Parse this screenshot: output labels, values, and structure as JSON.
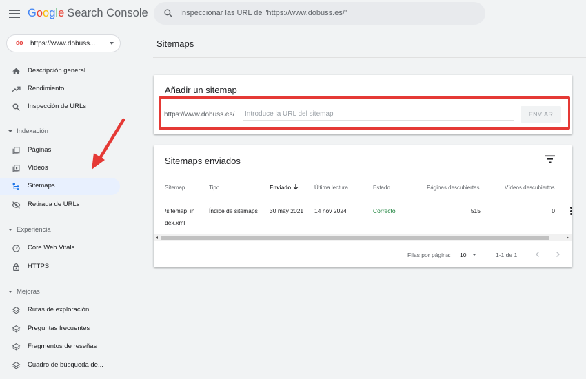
{
  "header": {
    "logo_google": [
      "G",
      "o",
      "o",
      "g",
      "l",
      "e"
    ],
    "logo_product": "Search Console",
    "search_placeholder": "Inspeccionar las URL de \"https://www.dobuss.es/\""
  },
  "sidebar": {
    "property": {
      "logo_text": "do",
      "label": "https://www.dobuss..."
    },
    "items": [
      {
        "label": "Descripción general",
        "icon": "home-icon"
      },
      {
        "label": "Rendimiento",
        "icon": "trending-up-icon"
      },
      {
        "label": "Inspección de URLs",
        "icon": "search-icon"
      },
      {
        "label": "Páginas",
        "icon": "pages-icon"
      },
      {
        "label": "Vídeos",
        "icon": "video-icon"
      },
      {
        "label": "Sitemaps",
        "icon": "sitemap-icon",
        "active": true
      },
      {
        "label": "Retirada de URLs",
        "icon": "removal-icon"
      },
      {
        "label": "Core Web Vitals",
        "icon": "gauge-icon"
      },
      {
        "label": "HTTPS",
        "icon": "lock-icon"
      },
      {
        "label": "Rutas de exploración",
        "icon": "layers-icon"
      },
      {
        "label": "Preguntas frecuentes",
        "icon": "layers-icon"
      },
      {
        "label": "Fragmentos de reseñas",
        "icon": "layers-icon"
      },
      {
        "label": "Cuadro de búsqueda de...",
        "icon": "layers-icon"
      }
    ],
    "sections": [
      "Indexación",
      "Experiencia",
      "Mejoras"
    ]
  },
  "main": {
    "page_title": "Sitemaps",
    "add_sitemap": {
      "title": "Añadir un sitemap",
      "url_prefix": "https://www.dobuss.es/",
      "input_placeholder": "Introduce la URL del sitemap",
      "submit_label": "ENVIAR"
    },
    "submitted": {
      "title": "Sitemaps enviados",
      "columns": [
        "Sitemap",
        "Tipo",
        "Enviado",
        "Última lectura",
        "Estado",
        "Páginas descubiertas",
        "Vídeos descubiertos"
      ],
      "sorted_column": "Enviado",
      "rows": [
        {
          "sitemap": [
            "/sitemap_in",
            "dex.xml"
          ],
          "type": "Índice de sitemaps",
          "submitted": "30 may 2021",
          "last_read": "14 nov 2024",
          "status": "Correcto",
          "pages": "515",
          "videos": "0"
        }
      ],
      "pagination": {
        "rows_label": "Filas por página:",
        "rows_per_page": "10",
        "range": "1-1 de 1"
      }
    }
  },
  "colors": {
    "accent_blue": "#1a73e8",
    "active_bg": "#e8f0fe",
    "success_green": "#188038",
    "annotation_red": "#e53935"
  }
}
